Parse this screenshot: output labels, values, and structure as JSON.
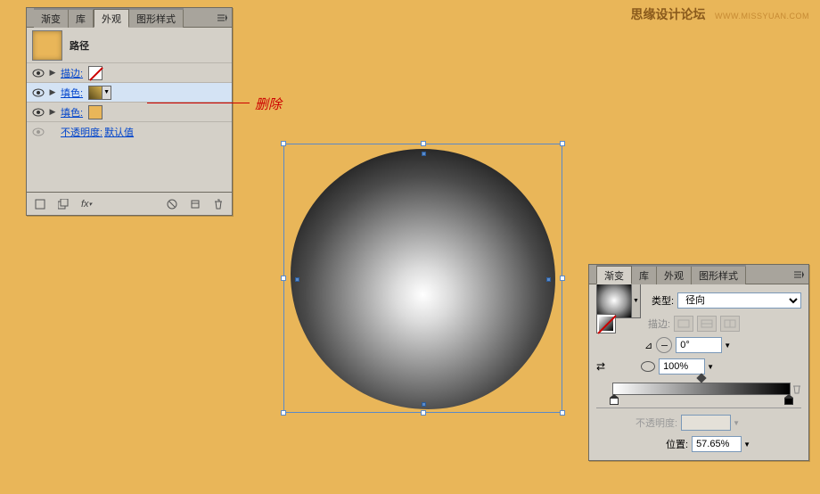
{
  "watermark": {
    "t1": "思缘设计论坛",
    "t2": "WWW.MISSYUAN.COM"
  },
  "annotation": "删除",
  "appearance_panel": {
    "tabs": [
      "渐变",
      "库",
      "外观",
      "图形样式"
    ],
    "active_tab": 2,
    "header": "路径",
    "rows": [
      {
        "label": "描边:",
        "swatch": "none"
      },
      {
        "label": "填色:",
        "swatch": "gradient",
        "selected": true
      },
      {
        "label": "填色:",
        "swatch": "orange"
      }
    ],
    "opacity_row": {
      "label": "不透明度:",
      "value": "默认值"
    }
  },
  "gradient_panel": {
    "tabs": [
      "渐变",
      "库",
      "外观",
      "图形样式"
    ],
    "active_tab": 0,
    "type_label": "类型:",
    "type_value": "径向",
    "stroke_label": "描边:",
    "angle_value": "0°",
    "aspect_value": "100%",
    "opacity_label": "不透明度:",
    "position_label": "位置:",
    "position_value": "57.65%"
  },
  "chart_data": {
    "type": "radial-gradient-preview",
    "stops": [
      {
        "position": 0,
        "color": "#ffffff"
      },
      {
        "position": 100,
        "color": "#000000"
      }
    ],
    "angle": 0,
    "aspect": 100,
    "selected_stop_position": 57.65
  }
}
